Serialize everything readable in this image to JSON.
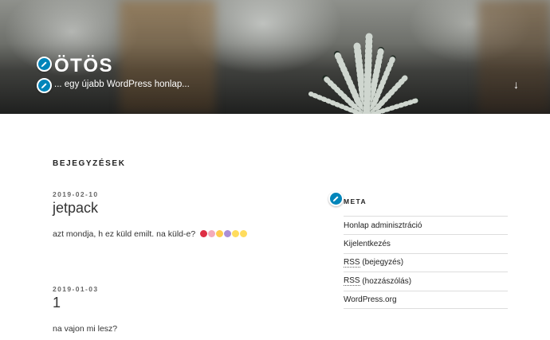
{
  "header": {
    "site_title": "ÖTÖS",
    "site_description": "... egy újabb WordPress honlap...",
    "scroll_down_glyph": "↓"
  },
  "main": {
    "page_title": "BEJEGYZÉSEK",
    "posts": [
      {
        "date": "2019-02-10",
        "title": "jetpack",
        "excerpt": "azt mondja, h ez küld emilt. na küld-e?",
        "emojis": [
          "red-heart",
          "sparkling-heart",
          "heart-eyes",
          "smiling-imp",
          "clapping-hands",
          "clapping-hands"
        ]
      },
      {
        "date": "2019-01-03",
        "title": "1",
        "excerpt": "na vajon mi lesz?"
      }
    ]
  },
  "sidebar": {
    "widget_title": "META",
    "links": [
      {
        "label": "Honlap adminisztráció"
      },
      {
        "label": "Kijelentkezés"
      },
      {
        "abbr": "RSS",
        "label": " (bejegyzés)"
      },
      {
        "abbr": "RSS",
        "label": " (hozzászólás)"
      },
      {
        "label": "WordPress.org"
      }
    ]
  },
  "colors": {
    "edit_icon": "#0085ba",
    "text": "#222222",
    "divider": "#dddddd"
  },
  "icons": {
    "customize_edit": "pencil-icon",
    "scroll_down": "arrow-down-icon"
  }
}
